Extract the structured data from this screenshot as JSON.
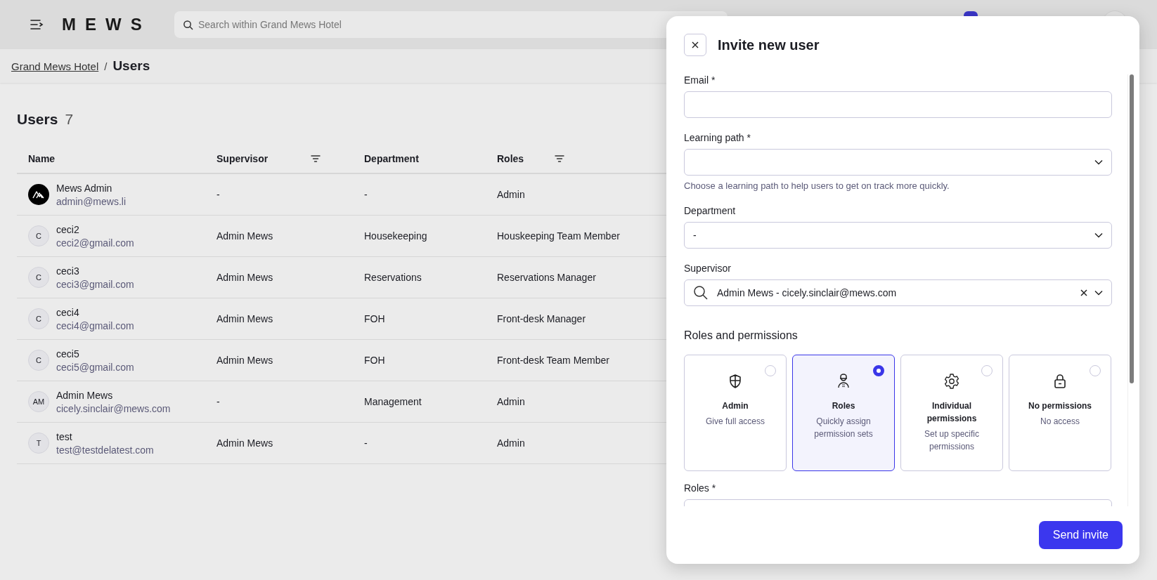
{
  "topbar": {
    "logo": "MEWS",
    "search_placeholder": "Search within Grand Mews Hotel"
  },
  "breadcrumb": {
    "items": [
      {
        "label": "Grand Mews Hotel",
        "kind": "link"
      },
      {
        "label": "Users",
        "kind": "current"
      }
    ],
    "separator": "/"
  },
  "page": {
    "title": "Users",
    "count": "7"
  },
  "table": {
    "columns": [
      {
        "label": "Name",
        "filter": false
      },
      {
        "label": "Supervisor",
        "filter": true
      },
      {
        "label": "Department",
        "filter": false
      },
      {
        "label": "Roles",
        "filter": true
      }
    ],
    "rows": [
      {
        "avatar": {
          "kind": "logo"
        },
        "name": "Mews Admin",
        "email": "admin@mews.li",
        "supervisor": "-",
        "department": "-",
        "roles": "Admin"
      },
      {
        "avatar": {
          "kind": "initials",
          "initials": "C"
        },
        "name": "ceci2",
        "email": "ceci2@gmail.com",
        "supervisor": "Admin Mews",
        "department": "Housekeeping",
        "roles": "Houskeeping Team Member"
      },
      {
        "avatar": {
          "kind": "initials",
          "initials": "C"
        },
        "name": "ceci3",
        "email": "ceci3@gmail.com",
        "supervisor": "Admin Mews",
        "department": "Reservations",
        "roles": "Reservations Manager"
      },
      {
        "avatar": {
          "kind": "initials",
          "initials": "C"
        },
        "name": "ceci4",
        "email": "ceci4@gmail.com",
        "supervisor": "Admin Mews",
        "department": "FOH",
        "roles": "Front-desk Manager"
      },
      {
        "avatar": {
          "kind": "initials",
          "initials": "C"
        },
        "name": "ceci5",
        "email": "ceci5@gmail.com",
        "supervisor": "Admin Mews",
        "department": "FOH",
        "roles": "Front-desk Team Member"
      },
      {
        "avatar": {
          "kind": "initials",
          "initials": "AM"
        },
        "name": "Admin Mews",
        "email": "cicely.sinclair@mews.com",
        "supervisor": "-",
        "department": "Management",
        "roles": "Admin"
      },
      {
        "avatar": {
          "kind": "initials",
          "initials": "T"
        },
        "name": "test",
        "email": "test@testdelatest.com",
        "supervisor": "Admin Mews",
        "department": "-",
        "roles": "Admin"
      }
    ]
  },
  "modal": {
    "title": "Invite new user",
    "fields": [
      {
        "kind": "text",
        "label": "Email *"
      },
      {
        "kind": "select",
        "label": "Learning path *",
        "hint": "Choose a learning path to help users to get on track more quickly."
      },
      {
        "kind": "select",
        "label": "Department",
        "value": "-"
      },
      {
        "kind": "search",
        "label": "Supervisor",
        "value": "Admin Mews - cicely.sinclair@mews.com"
      }
    ],
    "section_title": "Roles and permissions",
    "options": [
      {
        "title": "Admin",
        "description": "Give full access",
        "selected": false
      },
      {
        "title": "Roles",
        "description": "Quickly assign permission sets",
        "selected": true
      },
      {
        "title": "Individual permissions",
        "description": "Set up specific permissions",
        "selected": false
      },
      {
        "title": "No permissions",
        "description": "No access",
        "selected": false
      }
    ],
    "roles_label": "Roles *",
    "button": "Send invite"
  }
}
